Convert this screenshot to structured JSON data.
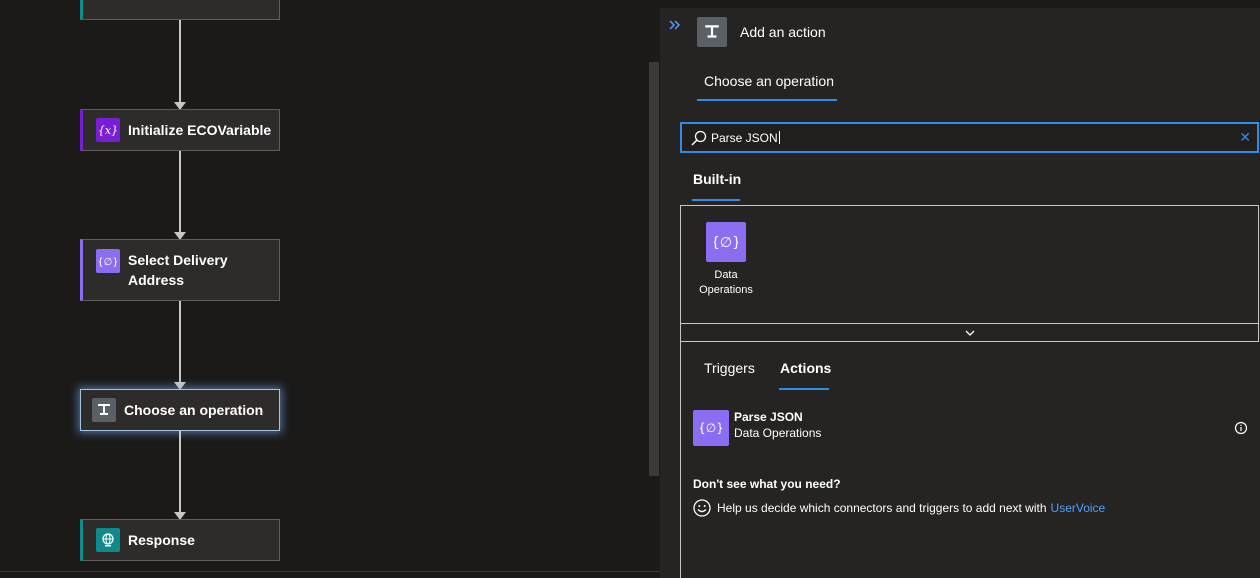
{
  "canvas": {
    "cards": {
      "init_variable": {
        "label": "Initialize ECOVariable"
      },
      "select_address": {
        "label": "Select Delivery Address"
      },
      "choose_operation": {
        "label": "Choose an operation"
      },
      "response": {
        "label": "Response"
      }
    }
  },
  "panel": {
    "title": "Add an action",
    "operation_tab": "Choose an operation",
    "search": {
      "value": "Parse JSON"
    },
    "builtin_tab": "Built-in",
    "connectors": [
      {
        "label": "Data Operations",
        "icon": "data-operations-icon"
      }
    ],
    "result_tabs": {
      "triggers": "Triggers",
      "actions": "Actions"
    },
    "actions": [
      {
        "name": "Parse JSON",
        "connector": "Data Operations"
      }
    ],
    "help": {
      "question": "Don't see what you need?",
      "text": "Help us decide which connectors and triggers to add next with",
      "link": "UserVoice"
    }
  },
  "colors": {
    "accent": "#2f8de4",
    "data_operations": "#8c6cf0",
    "variable": "#7a1ed6",
    "response": "#0e8a8a"
  }
}
